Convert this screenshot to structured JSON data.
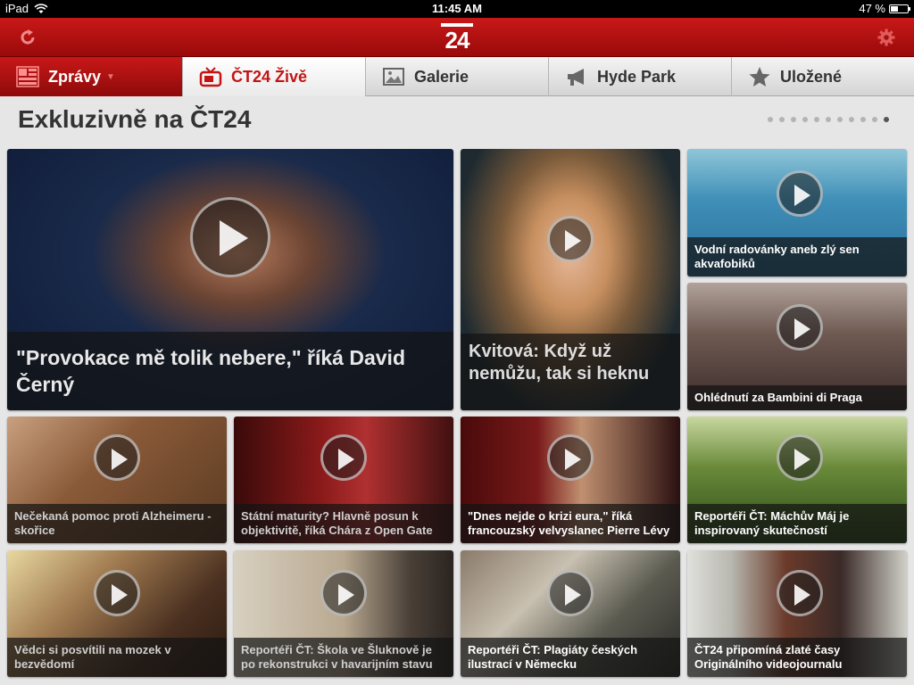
{
  "status": {
    "device": "iPad",
    "time": "11:45 AM",
    "battery": "47 %",
    "battery_level": 0.47
  },
  "header": {
    "logo": "24"
  },
  "tabs": [
    {
      "label": "Zprávy",
      "icon": "grid-icon",
      "caret": "▼"
    },
    {
      "label": "ČT24 Živě",
      "icon": "tv-icon"
    },
    {
      "label": "Galerie",
      "icon": "picture-icon"
    },
    {
      "label": "Hyde Park",
      "icon": "megaphone-icon"
    },
    {
      "label": "Uložené",
      "icon": "star-icon"
    }
  ],
  "section": {
    "title": "Exkluzivně na ČT24",
    "pages": 11,
    "current_page": 11
  },
  "tiles": [
    {
      "title": "\"Provokace mě tolik nebere,\" říká David Černý"
    },
    {
      "title": "Kvitová: Když už nemůžu, tak si heknu"
    },
    {
      "title": "Vodní radovánky aneb zlý sen akvafobiků"
    },
    {
      "title": "Ohlédnutí za Bambini di Praga"
    },
    {
      "title": "Nečekaná pomoc proti Alzheimeru - skořice"
    },
    {
      "title": "Státní maturity? Hlavně posun k objektivitě, říká Chára z Open Gate"
    },
    {
      "title": "\"Dnes nejde o krizi eura,\" říká francouzský velvyslanec Pierre Lévy"
    },
    {
      "title": "Reportéři ČT: Máchův Máj je inspirovaný skutečností"
    },
    {
      "title": "Vědci si posvítili na mozek v bezvědomí"
    },
    {
      "title": "Reportéři ČT: Škola ve Šluknově je po rekonstrukci v havarijním stavu"
    },
    {
      "title": "Reportéři ČT: Plagiáty českých ilustrací v Německu"
    },
    {
      "title": "ČT24 připomíná zlaté časy Originálního videojournalu"
    }
  ],
  "colors": {
    "brand_red": "#c41414",
    "tab_active_text": "#c41414"
  }
}
